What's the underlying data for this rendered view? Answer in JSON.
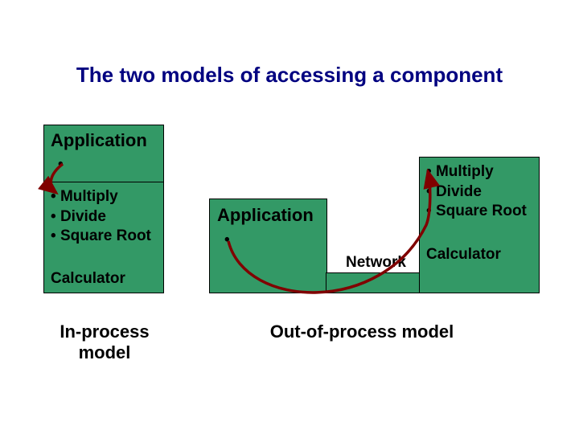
{
  "title": "The two models of accessing a component",
  "left": {
    "appLabel": "Application",
    "ops": [
      "Multiply",
      "Divide",
      "Square Root"
    ],
    "componentLabel": "Calculator",
    "modelLabel": "In-process\nmodel"
  },
  "right": {
    "appLabel": "Application",
    "ops": [
      "Multiply",
      "Divide",
      "Square Root"
    ],
    "componentLabel": "Calculator",
    "networkLabel": "Network",
    "modelLabel": "Out-of-process model"
  },
  "colors": {
    "boxFill": "#339966",
    "titleColor": "#000080",
    "arrow": "#800000"
  }
}
